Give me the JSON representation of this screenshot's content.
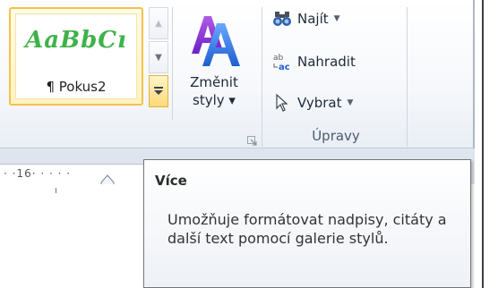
{
  "ribbon": {
    "styles_gallery": {
      "item_sample_text": "AaBbCı",
      "item_name": "¶ Pokus2",
      "scroll_up_icon": "triangle-up",
      "scroll_down_icon": "triangle-down",
      "more_icon": "more-dropdown"
    },
    "change_styles": {
      "line1": "Změnit",
      "line2": "styly ▾",
      "icon": "change-styles-AA-icon"
    },
    "editing": {
      "find_label": "Najít",
      "replace_label": "Nahradit",
      "select_label": "Vybrat",
      "group_label": "Úpravy"
    }
  },
  "ruler": {
    "text": "· ·16· · · · ·"
  },
  "tooltip": {
    "title": "Více",
    "body": "Umožňuje formátovat nadpisy, citáty a další text pomocí galerie stylů."
  },
  "colors": {
    "gallery_selected_border": "#f4c24b",
    "style_sample_green": "#3fb24b",
    "change_styles_blue": "#2f6fd6",
    "change_styles_purple": "#8a2be2"
  }
}
